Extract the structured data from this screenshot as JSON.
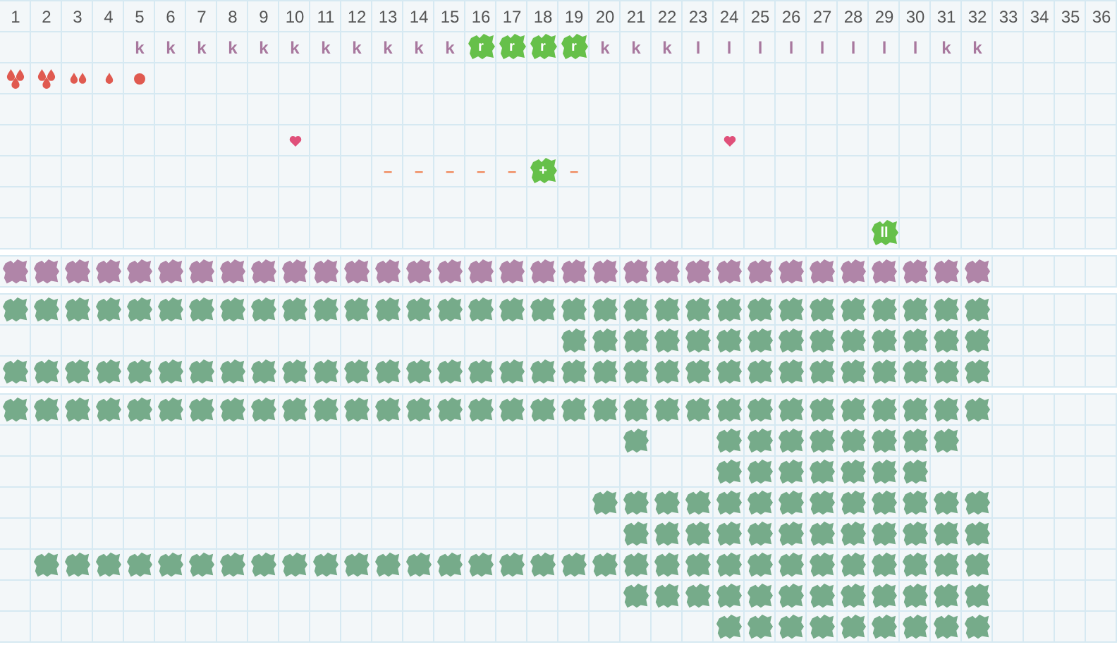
{
  "header": [
    "1",
    "2",
    "3",
    "4",
    "5",
    "6",
    "7",
    "8",
    "9",
    "10",
    "11",
    "12",
    "13",
    "14",
    "15",
    "16",
    "17",
    "18",
    "19",
    "20",
    "21",
    "22",
    "23",
    "24",
    "25",
    "26",
    "27",
    "28",
    "29",
    "30",
    "31",
    "32",
    "33",
    "34",
    "35",
    "36"
  ],
  "marker_rows": [
    {
      "cells": [
        {
          "kind": "empty"
        },
        {
          "kind": "empty"
        },
        {
          "kind": "empty"
        },
        {
          "kind": "empty"
        },
        {
          "kind": "letter",
          "text": "k"
        },
        {
          "kind": "letter",
          "text": "k"
        },
        {
          "kind": "letter",
          "text": "k"
        },
        {
          "kind": "letter",
          "text": "k"
        },
        {
          "kind": "letter",
          "text": "k"
        },
        {
          "kind": "letter",
          "text": "k"
        },
        {
          "kind": "letter",
          "text": "k"
        },
        {
          "kind": "letter",
          "text": "k"
        },
        {
          "kind": "letter",
          "text": "k"
        },
        {
          "kind": "letter",
          "text": "k"
        },
        {
          "kind": "letter",
          "text": "k"
        },
        {
          "kind": "tile",
          "text": "r"
        },
        {
          "kind": "tile",
          "text": "r"
        },
        {
          "kind": "tile",
          "text": "r"
        },
        {
          "kind": "tile",
          "text": "r"
        },
        {
          "kind": "letter",
          "text": "k"
        },
        {
          "kind": "letter",
          "text": "k"
        },
        {
          "kind": "letter",
          "text": "k"
        },
        {
          "kind": "letter",
          "text": "l"
        },
        {
          "kind": "letter",
          "text": "l"
        },
        {
          "kind": "letter",
          "text": "l"
        },
        {
          "kind": "letter",
          "text": "l"
        },
        {
          "kind": "letter",
          "text": "l"
        },
        {
          "kind": "letter",
          "text": "l"
        },
        {
          "kind": "letter",
          "text": "l"
        },
        {
          "kind": "letter",
          "text": "l"
        },
        {
          "kind": "letter",
          "text": "k"
        },
        {
          "kind": "letter",
          "text": "k"
        },
        {
          "kind": "empty"
        },
        {
          "kind": "empty"
        },
        {
          "kind": "empty"
        },
        {
          "kind": "empty"
        }
      ]
    },
    {
      "cells": [
        {
          "kind": "drop-cluster"
        },
        {
          "kind": "drop-cluster"
        },
        {
          "kind": "drop-pair"
        },
        {
          "kind": "drop"
        },
        {
          "kind": "dot"
        },
        {
          "kind": "empty"
        },
        {
          "kind": "empty"
        },
        {
          "kind": "empty"
        },
        {
          "kind": "empty"
        },
        {
          "kind": "empty"
        },
        {
          "kind": "empty"
        },
        {
          "kind": "empty"
        },
        {
          "kind": "empty"
        },
        {
          "kind": "empty"
        },
        {
          "kind": "empty"
        },
        {
          "kind": "empty"
        },
        {
          "kind": "empty"
        },
        {
          "kind": "empty"
        },
        {
          "kind": "empty"
        },
        {
          "kind": "empty"
        },
        {
          "kind": "empty"
        },
        {
          "kind": "empty"
        },
        {
          "kind": "empty"
        },
        {
          "kind": "empty"
        },
        {
          "kind": "empty"
        },
        {
          "kind": "empty"
        },
        {
          "kind": "empty"
        },
        {
          "kind": "empty"
        },
        {
          "kind": "empty"
        },
        {
          "kind": "empty"
        },
        {
          "kind": "empty"
        },
        {
          "kind": "empty"
        },
        {
          "kind": "empty"
        },
        {
          "kind": "empty"
        },
        {
          "kind": "empty"
        },
        {
          "kind": "empty"
        }
      ]
    },
    {
      "cells": [
        {
          "kind": "empty"
        },
        {
          "kind": "empty"
        },
        {
          "kind": "empty"
        },
        {
          "kind": "empty"
        },
        {
          "kind": "empty"
        },
        {
          "kind": "empty"
        },
        {
          "kind": "empty"
        },
        {
          "kind": "empty"
        },
        {
          "kind": "empty"
        },
        {
          "kind": "empty"
        },
        {
          "kind": "empty"
        },
        {
          "kind": "empty"
        },
        {
          "kind": "empty"
        },
        {
          "kind": "empty"
        },
        {
          "kind": "empty"
        },
        {
          "kind": "empty"
        },
        {
          "kind": "empty"
        },
        {
          "kind": "empty"
        },
        {
          "kind": "empty"
        },
        {
          "kind": "empty"
        },
        {
          "kind": "empty"
        },
        {
          "kind": "empty"
        },
        {
          "kind": "empty"
        },
        {
          "kind": "empty"
        },
        {
          "kind": "empty"
        },
        {
          "kind": "empty"
        },
        {
          "kind": "empty"
        },
        {
          "kind": "empty"
        },
        {
          "kind": "empty"
        },
        {
          "kind": "empty"
        },
        {
          "kind": "empty"
        },
        {
          "kind": "empty"
        },
        {
          "kind": "empty"
        },
        {
          "kind": "empty"
        },
        {
          "kind": "empty"
        },
        {
          "kind": "empty"
        }
      ]
    },
    {
      "cells": [
        {
          "kind": "empty"
        },
        {
          "kind": "empty"
        },
        {
          "kind": "empty"
        },
        {
          "kind": "empty"
        },
        {
          "kind": "empty"
        },
        {
          "kind": "empty"
        },
        {
          "kind": "empty"
        },
        {
          "kind": "empty"
        },
        {
          "kind": "empty"
        },
        {
          "kind": "heart"
        },
        {
          "kind": "empty"
        },
        {
          "kind": "empty"
        },
        {
          "kind": "empty"
        },
        {
          "kind": "empty"
        },
        {
          "kind": "empty"
        },
        {
          "kind": "empty"
        },
        {
          "kind": "empty"
        },
        {
          "kind": "empty"
        },
        {
          "kind": "empty"
        },
        {
          "kind": "empty"
        },
        {
          "kind": "empty"
        },
        {
          "kind": "empty"
        },
        {
          "kind": "empty"
        },
        {
          "kind": "heart"
        },
        {
          "kind": "empty"
        },
        {
          "kind": "empty"
        },
        {
          "kind": "empty"
        },
        {
          "kind": "empty"
        },
        {
          "kind": "empty"
        },
        {
          "kind": "empty"
        },
        {
          "kind": "empty"
        },
        {
          "kind": "empty"
        },
        {
          "kind": "empty"
        },
        {
          "kind": "empty"
        },
        {
          "kind": "empty"
        },
        {
          "kind": "empty"
        }
      ]
    },
    {
      "cells": [
        {
          "kind": "empty"
        },
        {
          "kind": "empty"
        },
        {
          "kind": "empty"
        },
        {
          "kind": "empty"
        },
        {
          "kind": "empty"
        },
        {
          "kind": "empty"
        },
        {
          "kind": "empty"
        },
        {
          "kind": "empty"
        },
        {
          "kind": "empty"
        },
        {
          "kind": "empty"
        },
        {
          "kind": "empty"
        },
        {
          "kind": "empty"
        },
        {
          "kind": "dash",
          "text": "–"
        },
        {
          "kind": "dash",
          "text": "–"
        },
        {
          "kind": "dash",
          "text": "–"
        },
        {
          "kind": "dash",
          "text": "–"
        },
        {
          "kind": "dash",
          "text": "–"
        },
        {
          "kind": "tile",
          "text": "+"
        },
        {
          "kind": "dash",
          "text": "–"
        },
        {
          "kind": "empty"
        },
        {
          "kind": "empty"
        },
        {
          "kind": "empty"
        },
        {
          "kind": "empty"
        },
        {
          "kind": "empty"
        },
        {
          "kind": "empty"
        },
        {
          "kind": "empty"
        },
        {
          "kind": "empty"
        },
        {
          "kind": "empty"
        },
        {
          "kind": "empty"
        },
        {
          "kind": "empty"
        },
        {
          "kind": "empty"
        },
        {
          "kind": "empty"
        },
        {
          "kind": "empty"
        },
        {
          "kind": "empty"
        },
        {
          "kind": "empty"
        },
        {
          "kind": "empty"
        }
      ]
    },
    {
      "cells": [
        {
          "kind": "empty"
        },
        {
          "kind": "empty"
        },
        {
          "kind": "empty"
        },
        {
          "kind": "empty"
        },
        {
          "kind": "empty"
        },
        {
          "kind": "empty"
        },
        {
          "kind": "empty"
        },
        {
          "kind": "empty"
        },
        {
          "kind": "empty"
        },
        {
          "kind": "empty"
        },
        {
          "kind": "empty"
        },
        {
          "kind": "empty"
        },
        {
          "kind": "empty"
        },
        {
          "kind": "empty"
        },
        {
          "kind": "empty"
        },
        {
          "kind": "empty"
        },
        {
          "kind": "empty"
        },
        {
          "kind": "empty"
        },
        {
          "kind": "empty"
        },
        {
          "kind": "empty"
        },
        {
          "kind": "empty"
        },
        {
          "kind": "empty"
        },
        {
          "kind": "empty"
        },
        {
          "kind": "empty"
        },
        {
          "kind": "empty"
        },
        {
          "kind": "empty"
        },
        {
          "kind": "empty"
        },
        {
          "kind": "empty"
        },
        {
          "kind": "empty"
        },
        {
          "kind": "empty"
        },
        {
          "kind": "empty"
        },
        {
          "kind": "empty"
        },
        {
          "kind": "empty"
        },
        {
          "kind": "empty"
        },
        {
          "kind": "empty"
        },
        {
          "kind": "empty"
        }
      ]
    },
    {
      "cells": [
        {
          "kind": "empty"
        },
        {
          "kind": "empty"
        },
        {
          "kind": "empty"
        },
        {
          "kind": "empty"
        },
        {
          "kind": "empty"
        },
        {
          "kind": "empty"
        },
        {
          "kind": "empty"
        },
        {
          "kind": "empty"
        },
        {
          "kind": "empty"
        },
        {
          "kind": "empty"
        },
        {
          "kind": "empty"
        },
        {
          "kind": "empty"
        },
        {
          "kind": "empty"
        },
        {
          "kind": "empty"
        },
        {
          "kind": "empty"
        },
        {
          "kind": "empty"
        },
        {
          "kind": "empty"
        },
        {
          "kind": "empty"
        },
        {
          "kind": "empty"
        },
        {
          "kind": "empty"
        },
        {
          "kind": "empty"
        },
        {
          "kind": "empty"
        },
        {
          "kind": "empty"
        },
        {
          "kind": "empty"
        },
        {
          "kind": "empty"
        },
        {
          "kind": "empty"
        },
        {
          "kind": "empty"
        },
        {
          "kind": "empty"
        },
        {
          "kind": "tile",
          "text": "ll"
        },
        {
          "kind": "empty"
        },
        {
          "kind": "empty"
        },
        {
          "kind": "empty"
        },
        {
          "kind": "empty"
        },
        {
          "kind": "empty"
        },
        {
          "kind": "empty"
        },
        {
          "kind": "empty"
        }
      ]
    }
  ],
  "block_sections": [
    {
      "color": "#b085a8",
      "rows": [
        {
          "cells": [
            {
              "kind": "block"
            },
            {
              "kind": "block"
            },
            {
              "kind": "block"
            },
            {
              "kind": "block"
            },
            {
              "kind": "block"
            },
            {
              "kind": "block"
            },
            {
              "kind": "block"
            },
            {
              "kind": "block"
            },
            {
              "kind": "block"
            },
            {
              "kind": "block"
            },
            {
              "kind": "block"
            },
            {
              "kind": "block"
            },
            {
              "kind": "block"
            },
            {
              "kind": "block"
            },
            {
              "kind": "block"
            },
            {
              "kind": "block"
            },
            {
              "kind": "block"
            },
            {
              "kind": "block"
            },
            {
              "kind": "block"
            },
            {
              "kind": "block"
            },
            {
              "kind": "block"
            },
            {
              "kind": "block"
            },
            {
              "kind": "block"
            },
            {
              "kind": "block"
            },
            {
              "kind": "block"
            },
            {
              "kind": "block"
            },
            {
              "kind": "block"
            },
            {
              "kind": "block"
            },
            {
              "kind": "block"
            },
            {
              "kind": "block"
            },
            {
              "kind": "block"
            },
            {
              "kind": "block"
            },
            {
              "kind": "blank"
            },
            {
              "kind": "blank"
            },
            {
              "kind": "blank"
            },
            {
              "kind": "blank"
            }
          ]
        }
      ]
    },
    {
      "color": "#76ab8a",
      "rows": [
        {
          "cells": [
            {
              "kind": "block"
            },
            {
              "kind": "block"
            },
            {
              "kind": "block"
            },
            {
              "kind": "block"
            },
            {
              "kind": "block"
            },
            {
              "kind": "block"
            },
            {
              "kind": "block"
            },
            {
              "kind": "block"
            },
            {
              "kind": "block"
            },
            {
              "kind": "block"
            },
            {
              "kind": "block"
            },
            {
              "kind": "block"
            },
            {
              "kind": "block"
            },
            {
              "kind": "block"
            },
            {
              "kind": "block"
            },
            {
              "kind": "block"
            },
            {
              "kind": "block"
            },
            {
              "kind": "block"
            },
            {
              "kind": "block"
            },
            {
              "kind": "block"
            },
            {
              "kind": "block"
            },
            {
              "kind": "block"
            },
            {
              "kind": "block"
            },
            {
              "kind": "block"
            },
            {
              "kind": "block"
            },
            {
              "kind": "block"
            },
            {
              "kind": "block"
            },
            {
              "kind": "block"
            },
            {
              "kind": "block"
            },
            {
              "kind": "block"
            },
            {
              "kind": "block"
            },
            {
              "kind": "block"
            },
            {
              "kind": "blank"
            },
            {
              "kind": "blank"
            },
            {
              "kind": "blank"
            },
            {
              "kind": "blank"
            }
          ]
        },
        {
          "cells": [
            {
              "kind": "blank"
            },
            {
              "kind": "blank"
            },
            {
              "kind": "blank"
            },
            {
              "kind": "blank"
            },
            {
              "kind": "blank"
            },
            {
              "kind": "blank"
            },
            {
              "kind": "blank"
            },
            {
              "kind": "blank"
            },
            {
              "kind": "blank"
            },
            {
              "kind": "blank"
            },
            {
              "kind": "blank"
            },
            {
              "kind": "blank"
            },
            {
              "kind": "blank"
            },
            {
              "kind": "blank"
            },
            {
              "kind": "blank"
            },
            {
              "kind": "blank"
            },
            {
              "kind": "blank"
            },
            {
              "kind": "blank"
            },
            {
              "kind": "block"
            },
            {
              "kind": "block"
            },
            {
              "kind": "block"
            },
            {
              "kind": "block"
            },
            {
              "kind": "block"
            },
            {
              "kind": "block"
            },
            {
              "kind": "block"
            },
            {
              "kind": "block"
            },
            {
              "kind": "block"
            },
            {
              "kind": "block"
            },
            {
              "kind": "block"
            },
            {
              "kind": "block"
            },
            {
              "kind": "block"
            },
            {
              "kind": "block"
            },
            {
              "kind": "blank"
            },
            {
              "kind": "blank"
            },
            {
              "kind": "blank"
            },
            {
              "kind": "blank"
            }
          ]
        },
        {
          "cells": [
            {
              "kind": "block"
            },
            {
              "kind": "block"
            },
            {
              "kind": "block"
            },
            {
              "kind": "block"
            },
            {
              "kind": "block"
            },
            {
              "kind": "block"
            },
            {
              "kind": "block"
            },
            {
              "kind": "block"
            },
            {
              "kind": "block"
            },
            {
              "kind": "block"
            },
            {
              "kind": "block"
            },
            {
              "kind": "block"
            },
            {
              "kind": "block"
            },
            {
              "kind": "block"
            },
            {
              "kind": "block"
            },
            {
              "kind": "block"
            },
            {
              "kind": "block"
            },
            {
              "kind": "block"
            },
            {
              "kind": "block"
            },
            {
              "kind": "block"
            },
            {
              "kind": "block"
            },
            {
              "kind": "block"
            },
            {
              "kind": "block"
            },
            {
              "kind": "block"
            },
            {
              "kind": "block"
            },
            {
              "kind": "block"
            },
            {
              "kind": "block"
            },
            {
              "kind": "block"
            },
            {
              "kind": "block"
            },
            {
              "kind": "block"
            },
            {
              "kind": "block"
            },
            {
              "kind": "block"
            },
            {
              "kind": "blank"
            },
            {
              "kind": "blank"
            },
            {
              "kind": "blank"
            },
            {
              "kind": "blank"
            }
          ]
        }
      ]
    },
    {
      "color": "#76ab8a",
      "rows": [
        {
          "cells": [
            {
              "kind": "block"
            },
            {
              "kind": "block"
            },
            {
              "kind": "block"
            },
            {
              "kind": "block"
            },
            {
              "kind": "block"
            },
            {
              "kind": "block"
            },
            {
              "kind": "block"
            },
            {
              "kind": "block"
            },
            {
              "kind": "block"
            },
            {
              "kind": "block"
            },
            {
              "kind": "block"
            },
            {
              "kind": "block"
            },
            {
              "kind": "block"
            },
            {
              "kind": "block"
            },
            {
              "kind": "block"
            },
            {
              "kind": "block"
            },
            {
              "kind": "block"
            },
            {
              "kind": "block"
            },
            {
              "kind": "block"
            },
            {
              "kind": "block"
            },
            {
              "kind": "block"
            },
            {
              "kind": "block"
            },
            {
              "kind": "block"
            },
            {
              "kind": "block"
            },
            {
              "kind": "block"
            },
            {
              "kind": "block"
            },
            {
              "kind": "block"
            },
            {
              "kind": "block"
            },
            {
              "kind": "block"
            },
            {
              "kind": "block"
            },
            {
              "kind": "block"
            },
            {
              "kind": "block"
            },
            {
              "kind": "blank"
            },
            {
              "kind": "blank"
            },
            {
              "kind": "blank"
            },
            {
              "kind": "blank"
            }
          ]
        },
        {
          "cells": [
            {
              "kind": "blank"
            },
            {
              "kind": "blank"
            },
            {
              "kind": "blank"
            },
            {
              "kind": "blank"
            },
            {
              "kind": "blank"
            },
            {
              "kind": "blank"
            },
            {
              "kind": "blank"
            },
            {
              "kind": "blank"
            },
            {
              "kind": "blank"
            },
            {
              "kind": "blank"
            },
            {
              "kind": "blank"
            },
            {
              "kind": "blank"
            },
            {
              "kind": "blank"
            },
            {
              "kind": "blank"
            },
            {
              "kind": "blank"
            },
            {
              "kind": "blank"
            },
            {
              "kind": "blank"
            },
            {
              "kind": "blank"
            },
            {
              "kind": "blank"
            },
            {
              "kind": "blank"
            },
            {
              "kind": "block"
            },
            {
              "kind": "blank"
            },
            {
              "kind": "blank"
            },
            {
              "kind": "block"
            },
            {
              "kind": "block"
            },
            {
              "kind": "block"
            },
            {
              "kind": "block"
            },
            {
              "kind": "block"
            },
            {
              "kind": "block"
            },
            {
              "kind": "block"
            },
            {
              "kind": "block"
            },
            {
              "kind": "blank"
            },
            {
              "kind": "blank"
            },
            {
              "kind": "blank"
            },
            {
              "kind": "blank"
            },
            {
              "kind": "blank"
            }
          ]
        },
        {
          "cells": [
            {
              "kind": "blank"
            },
            {
              "kind": "blank"
            },
            {
              "kind": "blank"
            },
            {
              "kind": "blank"
            },
            {
              "kind": "blank"
            },
            {
              "kind": "blank"
            },
            {
              "kind": "blank"
            },
            {
              "kind": "blank"
            },
            {
              "kind": "blank"
            },
            {
              "kind": "blank"
            },
            {
              "kind": "blank"
            },
            {
              "kind": "blank"
            },
            {
              "kind": "blank"
            },
            {
              "kind": "blank"
            },
            {
              "kind": "blank"
            },
            {
              "kind": "blank"
            },
            {
              "kind": "blank"
            },
            {
              "kind": "blank"
            },
            {
              "kind": "blank"
            },
            {
              "kind": "blank"
            },
            {
              "kind": "blank"
            },
            {
              "kind": "blank"
            },
            {
              "kind": "blank"
            },
            {
              "kind": "block"
            },
            {
              "kind": "block"
            },
            {
              "kind": "block"
            },
            {
              "kind": "block"
            },
            {
              "kind": "block"
            },
            {
              "kind": "block"
            },
            {
              "kind": "block"
            },
            {
              "kind": "blank"
            },
            {
              "kind": "blank"
            },
            {
              "kind": "blank"
            },
            {
              "kind": "blank"
            },
            {
              "kind": "blank"
            },
            {
              "kind": "blank"
            }
          ]
        },
        {
          "cells": [
            {
              "kind": "blank"
            },
            {
              "kind": "blank"
            },
            {
              "kind": "blank"
            },
            {
              "kind": "blank"
            },
            {
              "kind": "blank"
            },
            {
              "kind": "blank"
            },
            {
              "kind": "blank"
            },
            {
              "kind": "blank"
            },
            {
              "kind": "blank"
            },
            {
              "kind": "blank"
            },
            {
              "kind": "blank"
            },
            {
              "kind": "blank"
            },
            {
              "kind": "blank"
            },
            {
              "kind": "blank"
            },
            {
              "kind": "blank"
            },
            {
              "kind": "blank"
            },
            {
              "kind": "blank"
            },
            {
              "kind": "blank"
            },
            {
              "kind": "blank"
            },
            {
              "kind": "block"
            },
            {
              "kind": "block"
            },
            {
              "kind": "block"
            },
            {
              "kind": "block"
            },
            {
              "kind": "block"
            },
            {
              "kind": "block"
            },
            {
              "kind": "block"
            },
            {
              "kind": "block"
            },
            {
              "kind": "block"
            },
            {
              "kind": "block"
            },
            {
              "kind": "block"
            },
            {
              "kind": "block"
            },
            {
              "kind": "block"
            },
            {
              "kind": "blank"
            },
            {
              "kind": "blank"
            },
            {
              "kind": "blank"
            },
            {
              "kind": "blank"
            }
          ]
        },
        {
          "cells": [
            {
              "kind": "blank"
            },
            {
              "kind": "blank"
            },
            {
              "kind": "blank"
            },
            {
              "kind": "blank"
            },
            {
              "kind": "blank"
            },
            {
              "kind": "blank"
            },
            {
              "kind": "blank"
            },
            {
              "kind": "blank"
            },
            {
              "kind": "blank"
            },
            {
              "kind": "blank"
            },
            {
              "kind": "blank"
            },
            {
              "kind": "blank"
            },
            {
              "kind": "blank"
            },
            {
              "kind": "blank"
            },
            {
              "kind": "blank"
            },
            {
              "kind": "blank"
            },
            {
              "kind": "blank"
            },
            {
              "kind": "blank"
            },
            {
              "kind": "blank"
            },
            {
              "kind": "blank"
            },
            {
              "kind": "block"
            },
            {
              "kind": "block"
            },
            {
              "kind": "block"
            },
            {
              "kind": "block"
            },
            {
              "kind": "block"
            },
            {
              "kind": "block"
            },
            {
              "kind": "block"
            },
            {
              "kind": "block"
            },
            {
              "kind": "block"
            },
            {
              "kind": "block"
            },
            {
              "kind": "block"
            },
            {
              "kind": "block"
            },
            {
              "kind": "blank"
            },
            {
              "kind": "blank"
            },
            {
              "kind": "blank"
            },
            {
              "kind": "blank"
            }
          ]
        },
        {
          "cells": [
            {
              "kind": "blank"
            },
            {
              "kind": "block"
            },
            {
              "kind": "block"
            },
            {
              "kind": "block"
            },
            {
              "kind": "block"
            },
            {
              "kind": "block"
            },
            {
              "kind": "block"
            },
            {
              "kind": "block"
            },
            {
              "kind": "block"
            },
            {
              "kind": "block"
            },
            {
              "kind": "block"
            },
            {
              "kind": "block"
            },
            {
              "kind": "block"
            },
            {
              "kind": "block"
            },
            {
              "kind": "block"
            },
            {
              "kind": "block"
            },
            {
              "kind": "block"
            },
            {
              "kind": "block"
            },
            {
              "kind": "block"
            },
            {
              "kind": "block"
            },
            {
              "kind": "block"
            },
            {
              "kind": "block"
            },
            {
              "kind": "block"
            },
            {
              "kind": "block"
            },
            {
              "kind": "block"
            },
            {
              "kind": "block"
            },
            {
              "kind": "block"
            },
            {
              "kind": "block"
            },
            {
              "kind": "block"
            },
            {
              "kind": "block"
            },
            {
              "kind": "block"
            },
            {
              "kind": "block"
            },
            {
              "kind": "blank"
            },
            {
              "kind": "blank"
            },
            {
              "kind": "blank"
            },
            {
              "kind": "blank"
            }
          ]
        },
        {
          "cells": [
            {
              "kind": "blank"
            },
            {
              "kind": "blank"
            },
            {
              "kind": "blank"
            },
            {
              "kind": "blank"
            },
            {
              "kind": "blank"
            },
            {
              "kind": "blank"
            },
            {
              "kind": "blank"
            },
            {
              "kind": "blank"
            },
            {
              "kind": "blank"
            },
            {
              "kind": "blank"
            },
            {
              "kind": "blank"
            },
            {
              "kind": "blank"
            },
            {
              "kind": "blank"
            },
            {
              "kind": "blank"
            },
            {
              "kind": "blank"
            },
            {
              "kind": "blank"
            },
            {
              "kind": "blank"
            },
            {
              "kind": "blank"
            },
            {
              "kind": "blank"
            },
            {
              "kind": "blank"
            },
            {
              "kind": "block"
            },
            {
              "kind": "block"
            },
            {
              "kind": "block"
            },
            {
              "kind": "block"
            },
            {
              "kind": "block"
            },
            {
              "kind": "block"
            },
            {
              "kind": "block"
            },
            {
              "kind": "block"
            },
            {
              "kind": "block"
            },
            {
              "kind": "block"
            },
            {
              "kind": "block"
            },
            {
              "kind": "block"
            },
            {
              "kind": "blank"
            },
            {
              "kind": "blank"
            },
            {
              "kind": "blank"
            },
            {
              "kind": "blank"
            }
          ]
        },
        {
          "cells": [
            {
              "kind": "blank"
            },
            {
              "kind": "blank"
            },
            {
              "kind": "blank"
            },
            {
              "kind": "blank"
            },
            {
              "kind": "blank"
            },
            {
              "kind": "blank"
            },
            {
              "kind": "blank"
            },
            {
              "kind": "blank"
            },
            {
              "kind": "blank"
            },
            {
              "kind": "blank"
            },
            {
              "kind": "blank"
            },
            {
              "kind": "blank"
            },
            {
              "kind": "blank"
            },
            {
              "kind": "blank"
            },
            {
              "kind": "blank"
            },
            {
              "kind": "blank"
            },
            {
              "kind": "blank"
            },
            {
              "kind": "blank"
            },
            {
              "kind": "blank"
            },
            {
              "kind": "blank"
            },
            {
              "kind": "blank"
            },
            {
              "kind": "blank"
            },
            {
              "kind": "blank"
            },
            {
              "kind": "block"
            },
            {
              "kind": "block"
            },
            {
              "kind": "block"
            },
            {
              "kind": "block"
            },
            {
              "kind": "block"
            },
            {
              "kind": "block"
            },
            {
              "kind": "block"
            },
            {
              "kind": "block"
            },
            {
              "kind": "block"
            },
            {
              "kind": "blank"
            },
            {
              "kind": "blank"
            },
            {
              "kind": "blank"
            },
            {
              "kind": "blank"
            }
          ]
        }
      ]
    }
  ]
}
